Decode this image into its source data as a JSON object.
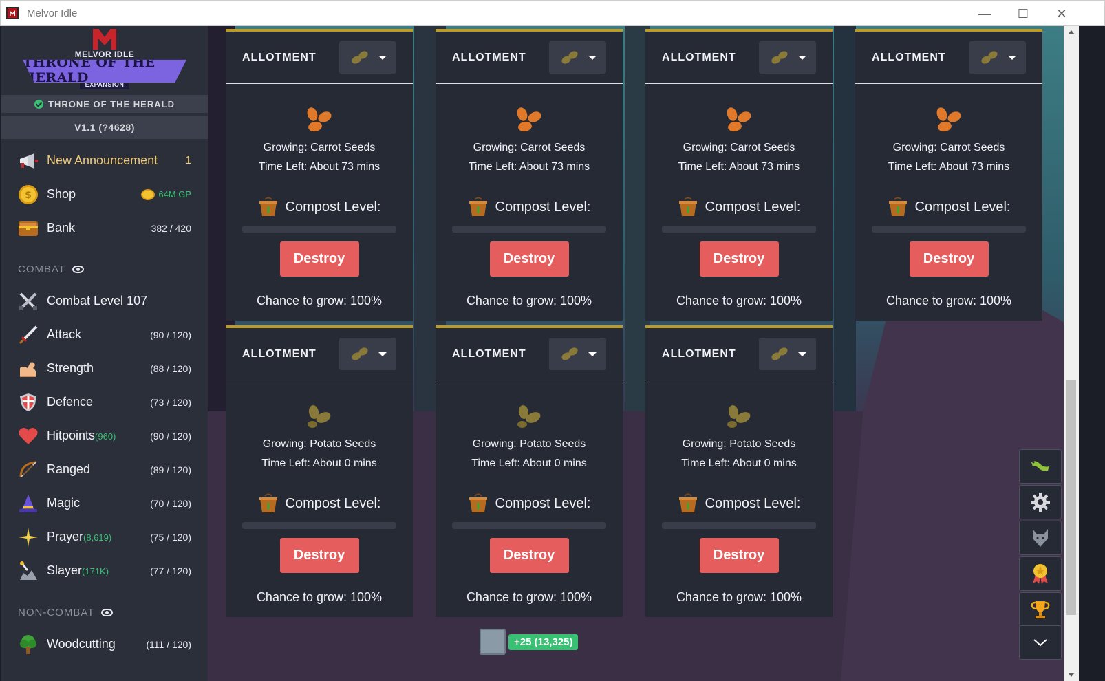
{
  "window": {
    "title": "Melvor Idle",
    "minimize": "—",
    "maximize": "☐",
    "close": "✕"
  },
  "sidebar": {
    "logo": {
      "top": "MELVOR IDLE",
      "banner": "THRONE OF THE HERALD",
      "sub": "EXPANSION"
    },
    "expansion": "THRONE OF THE HERALD",
    "version": "V1.1 (?4628)",
    "top_items": [
      {
        "label": "New Announcement",
        "value": "1"
      },
      {
        "label": "Shop",
        "value": "64M GP"
      },
      {
        "label": "Bank",
        "value": "382 / 420"
      }
    ],
    "combat_header": "COMBAT",
    "combat_items": [
      {
        "label": "Combat Level 107",
        "sub": "",
        "value": ""
      },
      {
        "label": "Attack",
        "sub": "",
        "value": "(90 / 120)"
      },
      {
        "label": "Strength",
        "sub": "",
        "value": "(88 / 120)"
      },
      {
        "label": "Defence",
        "sub": "",
        "value": "(73 / 120)"
      },
      {
        "label": "Hitpoints",
        "sub": "(960)",
        "value": "(90 / 120)"
      },
      {
        "label": "Ranged",
        "sub": "",
        "value": "(89 / 120)"
      },
      {
        "label": "Magic",
        "sub": "",
        "value": "(70 / 120)"
      },
      {
        "label": "Prayer",
        "sub": "(8,619)",
        "value": "(75 / 120)"
      },
      {
        "label": "Slayer",
        "sub": "(171K)",
        "value": "(77 / 120)"
      }
    ],
    "noncombat_header": "NON-COMBAT",
    "noncombat_items": [
      {
        "label": "Woodcutting",
        "value": "(111 / 120)"
      }
    ]
  },
  "plots": [
    {
      "title": "ALLOTMENT",
      "growing": "Growing: Carrot Seeds",
      "time": "Time Left: About 73 mins",
      "compost": "Compost Level:",
      "destroy": "Destroy",
      "chance": "Chance to grow: 100%"
    },
    {
      "title": "ALLOTMENT",
      "growing": "Growing: Carrot Seeds",
      "time": "Time Left: About 73 mins",
      "compost": "Compost Level:",
      "destroy": "Destroy",
      "chance": "Chance to grow: 100%"
    },
    {
      "title": "ALLOTMENT",
      "growing": "Growing: Carrot Seeds",
      "time": "Time Left: About 73 mins",
      "compost": "Compost Level:",
      "destroy": "Destroy",
      "chance": "Chance to grow: 100%"
    },
    {
      "title": "ALLOTMENT",
      "growing": "Growing: Carrot Seeds",
      "time": "Time Left: About 73 mins",
      "compost": "Compost Level:",
      "destroy": "Destroy",
      "chance": "Chance to grow: 100%"
    },
    {
      "title": "ALLOTMENT",
      "growing": "Growing: Potato Seeds",
      "time": "Time Left: About 0 mins",
      "compost": "Compost Level:",
      "destroy": "Destroy",
      "chance": "Chance to grow: 100%"
    },
    {
      "title": "ALLOTMENT",
      "growing": "Growing: Potato Seeds",
      "time": "Time Left: About 0 mins",
      "compost": "Compost Level:",
      "destroy": "Destroy",
      "chance": "Chance to grow: 100%"
    },
    {
      "title": "ALLOTMENT",
      "growing": "Growing: Potato Seeds",
      "time": "Time Left: About 0 mins",
      "compost": "Compost Level:",
      "destroy": "Destroy",
      "chance": "Chance to grow: 100%"
    }
  ],
  "xp_popup": "+25  (13,325)",
  "colors": {
    "accent_gold": "#bb9a26",
    "destroy": "#e65d5d",
    "success": "#38c172",
    "announce": "#f0c977"
  }
}
